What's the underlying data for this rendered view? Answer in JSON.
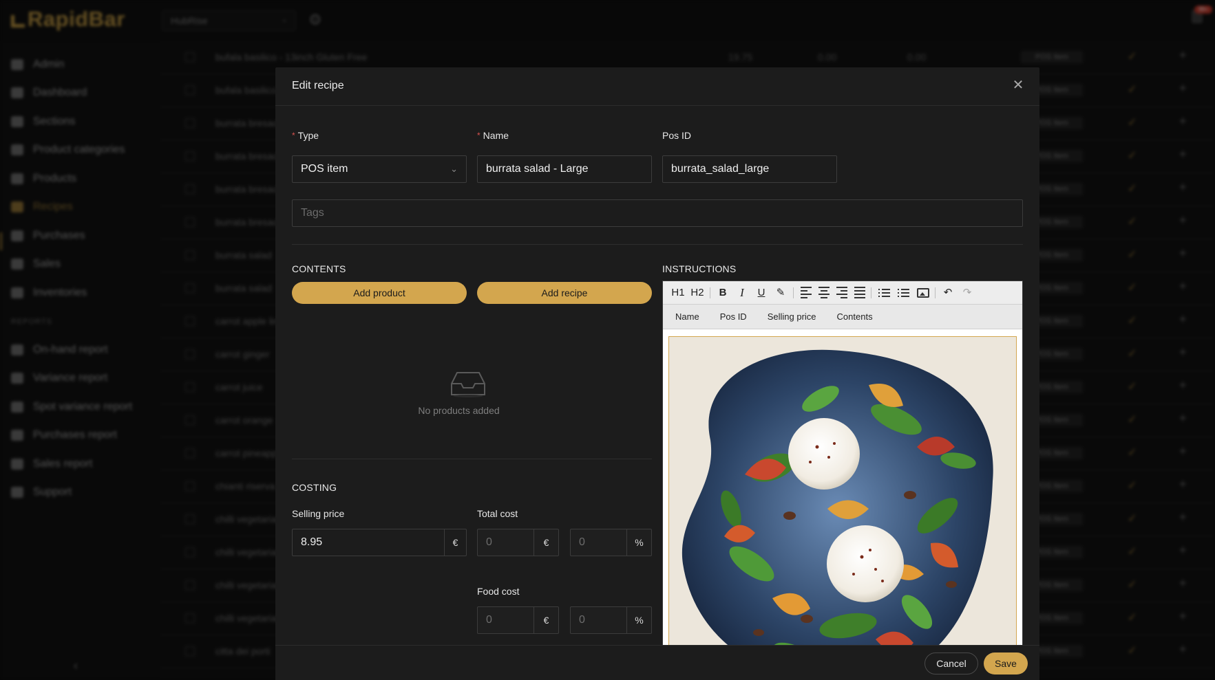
{
  "app": {
    "brand": "RapidBar",
    "org_select": "HubRise",
    "notifications_badge": "99+"
  },
  "sidebar": {
    "items": [
      {
        "label": "Admin",
        "icon": "user-cog-icon"
      },
      {
        "label": "Dashboard",
        "icon": "dashboard-icon"
      },
      {
        "label": "Sections",
        "icon": "map-pin-icon"
      },
      {
        "label": "Product categories",
        "icon": "tag-icon"
      },
      {
        "label": "Products",
        "icon": "boxes-icon"
      },
      {
        "label": "Recipes",
        "icon": "recipe-icon"
      },
      {
        "label": "Purchases",
        "icon": "cart-icon"
      },
      {
        "label": "Sales",
        "icon": "dollar-icon"
      },
      {
        "label": "Inventories",
        "icon": "inventory-icon"
      }
    ],
    "reports_heading": "REPORTS",
    "reports": [
      {
        "label": "On-hand report",
        "icon": "download-icon"
      },
      {
        "label": "Variance report",
        "icon": "line-chart-icon"
      },
      {
        "label": "Spot variance report",
        "icon": "line-chart-icon"
      },
      {
        "label": "Purchases report",
        "icon": "cart-icon"
      },
      {
        "label": "Sales report",
        "icon": "dollar-icon"
      },
      {
        "label": "Support",
        "icon": "support-icon"
      }
    ],
    "collapse_glyph": "‹"
  },
  "list": {
    "rows": [
      {
        "name": "bufala basilico - 13inch Gluten Free",
        "v1": "19.75",
        "v2": "0.00",
        "v3": "0.00",
        "badge": "POS Item"
      },
      {
        "name": "bufala basilico",
        "badge": "POS Item"
      },
      {
        "name": "burrata bresaola",
        "badge": "POS Item"
      },
      {
        "name": "burrata bresaola",
        "badge": "POS Item"
      },
      {
        "name": "burrata bresaola",
        "badge": "POS Item"
      },
      {
        "name": "burrata bresaola",
        "badge": "POS Item"
      },
      {
        "name": "burrata salad",
        "badge": "POS Item"
      },
      {
        "name": "burrata salad",
        "badge": "POS Item"
      },
      {
        "name": "carrot apple lime",
        "badge": "POS Item"
      },
      {
        "name": "carrot ginger",
        "badge": "POS Item"
      },
      {
        "name": "carrot juice",
        "badge": "POS Item"
      },
      {
        "name": "carrot orange",
        "badge": "POS Item"
      },
      {
        "name": "carrot pineapple",
        "badge": "POS Item"
      },
      {
        "name": "chianti riserva",
        "badge": "POS Item"
      },
      {
        "name": "chilli vegetarian",
        "badge": "POS Item"
      },
      {
        "name": "chilli vegetarian",
        "badge": "POS Item"
      },
      {
        "name": "chilli vegetarian",
        "badge": "POS Item"
      },
      {
        "name": "chilli vegetarian",
        "badge": "POS Item"
      },
      {
        "name": "citta dei porti",
        "badge": "POS Item"
      }
    ],
    "check_glyph": "✓",
    "plus_glyph": "+"
  },
  "modal": {
    "title": "Edit recipe",
    "close_glyph": "✕",
    "type_label": "Type",
    "type_value": "POS item",
    "name_label": "Name",
    "name_value": "burrata salad - Large",
    "posid_label": "Pos ID",
    "posid_value": "burrata_salad_large",
    "tags_placeholder": "Tags",
    "contents_title": "CONTENTS",
    "add_product_label": "Add product",
    "add_recipe_label": "Add recipe",
    "empty_text": "No products added",
    "costing_title": "COSTING",
    "selling_price_label": "Selling price",
    "selling_price_value": "8.95",
    "currency": "€",
    "percent": "%",
    "total_cost_label": "Total cost",
    "total_cost_value": "0",
    "total_cost_pct": "0",
    "food_cost_label": "Food cost",
    "food_cost_value": "0",
    "food_cost_pct": "0",
    "instructions_title": "INSTRUCTIONS",
    "toolbar": {
      "h1": "H1",
      "h2": "H2",
      "bold": "B",
      "italic": "I",
      "underline": "U",
      "highlight": "✎",
      "undo": "↶",
      "redo": "↷"
    },
    "variables": [
      "Name",
      "Pos ID",
      "Selling price",
      "Contents"
    ],
    "cancel_label": "Cancel",
    "save_label": "Save"
  },
  "colors": {
    "accent": "#d3a64e",
    "modal_bg": "#1c1c1c",
    "page_bg": "#0b0b0b"
  }
}
